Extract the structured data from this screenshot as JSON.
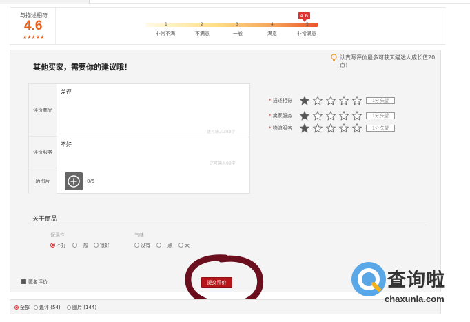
{
  "summary": {
    "label": "与描述相符",
    "score": "4.6",
    "stars": "★★★★★",
    "badge": "4.6",
    "scale_numbers": [
      "1",
      "2",
      "3",
      "4",
      "5"
    ],
    "scale_labels": [
      "非常不满",
      "不满意",
      "一般",
      "满意",
      "非常满意"
    ]
  },
  "form": {
    "tip": "认真写评价最多可获天猫达人成长值20点！",
    "heading": "其他买家，需要你的建议哦！",
    "rows": {
      "goods_label": "评价商品",
      "goods_text": "差评",
      "goods_counter": "还可输入388字",
      "service_label": "评价服务",
      "service_text": "不好",
      "service_counter": "还可输入98字",
      "photo_label": "晒图片",
      "photo_count": "0/5"
    },
    "ratings": [
      {
        "label": "描述相符",
        "value": 1,
        "tag": "1分 失望"
      },
      {
        "label": "卖家服务",
        "value": 1,
        "tag": "1分 失望"
      },
      {
        "label": "物流服务",
        "value": 1,
        "tag": "1分 失望"
      }
    ],
    "required_mark": "*",
    "about": "关于商品",
    "groups": [
      {
        "title": "保温性",
        "options": [
          "不好",
          "一般",
          "很好"
        ],
        "selected": "不好"
      },
      {
        "title": "气味",
        "options": [
          "没有",
          "一点",
          "大"
        ],
        "selected": ""
      }
    ],
    "anonymous": "匿名评价",
    "submit": "提交评价"
  },
  "filter": {
    "items": [
      "全部",
      "追评 (54)",
      "图片 (144)"
    ],
    "selected": "全部"
  },
  "watermark": {
    "title": "查询啦",
    "url": "chaxunla.com"
  },
  "colors": {
    "accent": "#e4611c",
    "submit": "#b5161a",
    "circle": "#6b0f1f",
    "watermark_blue": "#5aa7e8"
  }
}
